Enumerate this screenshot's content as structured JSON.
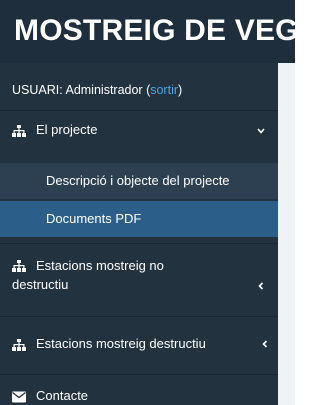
{
  "header": {
    "title": "MOSTREIG DE VEG"
  },
  "user": {
    "prefix": "USUARI: Administrador (",
    "logout": "sortir",
    "suffix": ")"
  },
  "menu": {
    "project": {
      "label": "El projecte",
      "icon": "sitemap-icon",
      "expanded": true,
      "sub": [
        {
          "label": "Descripció i objecte del projecte"
        },
        {
          "label": "Documents PDF",
          "active": true
        }
      ]
    },
    "nondestructive": {
      "line1": "Estacions mostreig no",
      "line2": "destructiu",
      "icon": "sitemap-icon"
    },
    "destructive": {
      "label": "Estacions mostreig destructiu",
      "icon": "sitemap-icon"
    },
    "contact": {
      "label": "Contacte",
      "icon": "envelope-icon"
    }
  },
  "colors": {
    "sidebar": "#23323f",
    "header": "#1f2e3c",
    "submenu": "#2d4052",
    "active": "#2b5f8a",
    "link": "#4aa6e8"
  }
}
